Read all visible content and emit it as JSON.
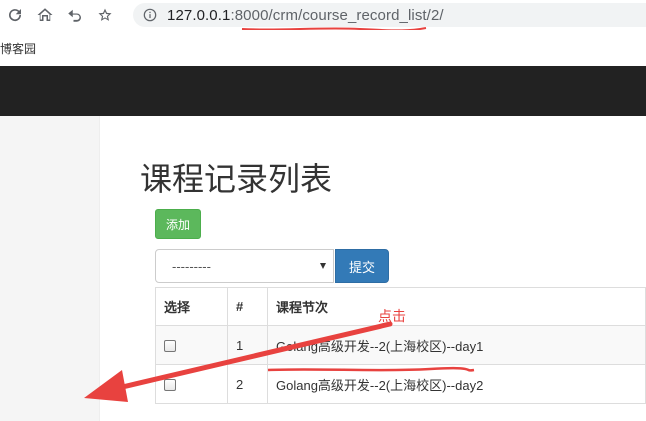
{
  "browser": {
    "url_host": "127.0.0.1",
    "url_rest": ":8000/crm/course_record_list/2/",
    "bookmark_label": "博客园"
  },
  "page": {
    "title": "课程记录列表",
    "add_button": "添加",
    "select_value": "---------",
    "submit_button": "提交"
  },
  "table": {
    "headers": [
      "选择",
      "#",
      "课程节次"
    ],
    "rows": [
      {
        "num": "1",
        "name": "Golang高级开发--2(上海校区)--day1"
      },
      {
        "num": "2",
        "name": "Golang高级开发--2(上海校区)--day2"
      }
    ]
  },
  "annotation": {
    "label": "点击",
    "color": "#e8423f"
  }
}
